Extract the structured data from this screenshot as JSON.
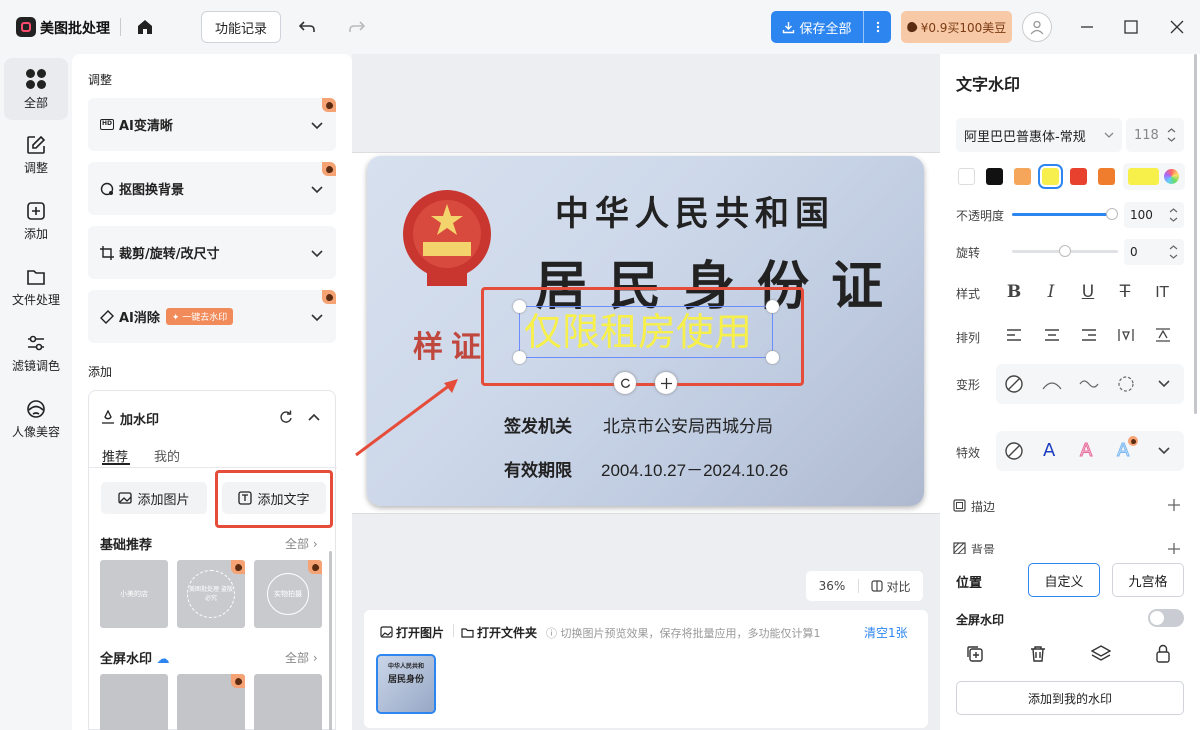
{
  "app": {
    "title": "美图批处理",
    "history_label": "功能记录",
    "save_all_label": "保存全部",
    "promo_label": "¥0.9买100美豆"
  },
  "nav": [
    {
      "label": "全部",
      "icon": "grid-icon"
    },
    {
      "label": "调整",
      "icon": "edit-icon"
    },
    {
      "label": "添加",
      "icon": "plus-square-icon"
    },
    {
      "label": "文件处理",
      "icon": "folder-icon"
    },
    {
      "label": "滤镜调色",
      "icon": "sliders-icon"
    },
    {
      "label": "人像美容",
      "icon": "face-icon"
    }
  ],
  "panel": {
    "adjust_section": "调整",
    "adjust_items": [
      "AI变清晰",
      "抠图换背景",
      "裁剪/旋转/改尺寸",
      "AI消除"
    ],
    "ai_erase_tag": "✦ 一键去水印",
    "add_section": "添加",
    "watermark_title": "加水印",
    "tabs": [
      "推荐",
      "我的"
    ],
    "add_image_label": "添加图片",
    "add_text_label": "添加文字",
    "basic_title": "基础推荐",
    "fullscreen_title": "全屏水印",
    "all_label": "全部",
    "thumb_labels": [
      "小美的店",
      "美图批处理 盗版必究",
      "实物拍摄"
    ]
  },
  "card": {
    "country": "中华人民共和国",
    "title": "居民身份证",
    "stamp": "样证",
    "authority_label": "签发机关",
    "authority_value": "北京市公安局西城分局",
    "validity_label": "有效期限",
    "validity_value": "2004.10.27－2024.10.26",
    "watermark_text": "仅限租房使用"
  },
  "canvas": {
    "zoom": "36%",
    "compare_label": "对比"
  },
  "bottom": {
    "open_image": "打开图片",
    "open_folder": "打开文件夹",
    "hint": "切换图片预览效果，保存将批量应用，多功能仅计算1",
    "clear_label": "清空1张",
    "thumb_text1": "中华人民共和",
    "thumb_text2": "居民身份"
  },
  "right": {
    "title": "文字水印",
    "font": "阿里巴巴普惠体-常规",
    "font_size": "118",
    "colors": [
      "#ffffff",
      "#111111",
      "#f5a65a",
      "#f7ef4d",
      "#e8422f",
      "#f07d2e"
    ],
    "current_color": "#f8f04a",
    "opacity_label": "不透明度",
    "opacity_value": "100",
    "opacity": 1.0,
    "rotate_label": "旋转",
    "rotate_value": "0",
    "rotate_level": 0.5,
    "style_label": "样式",
    "style_icons": [
      "B",
      "I",
      "U",
      "T",
      "IT"
    ],
    "align_label": "排列",
    "transform_label": "变形",
    "effect_label": "特效",
    "stroke_label": "描边",
    "background_label": "背景",
    "position_label": "位置",
    "position_options": [
      "自定义",
      "九宫格"
    ],
    "fullscreen_label": "全屏水印",
    "add_to_mine_label": "添加到我的水印"
  }
}
